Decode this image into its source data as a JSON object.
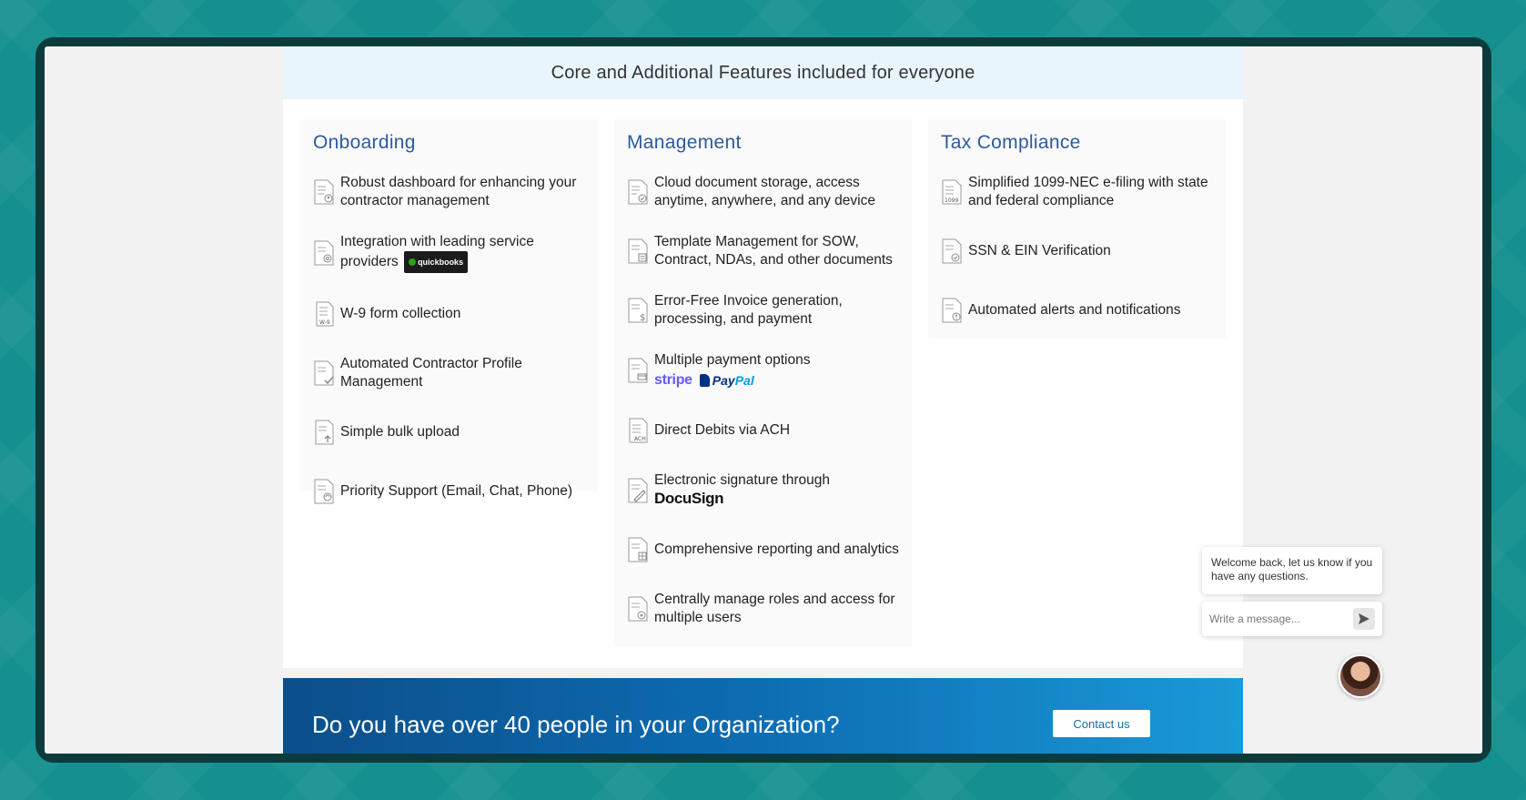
{
  "banner": {
    "title": "Core and Additional Features included for everyone"
  },
  "columns": [
    {
      "title": "Onboarding",
      "items": [
        "Robust dashboard for enhancing your contractor management",
        "Integration with leading service providers",
        "W-9 form collection",
        "Automated Contractor Profile Management",
        "Simple bulk upload",
        "Priority Support (Email, Chat, Phone)"
      ],
      "logos": {
        "quickbooks": "quickbooks",
        "w9": "W-9"
      }
    },
    {
      "title": "Management",
      "items": [
        "Cloud document storage, access anytime, anywhere, and any device",
        "Template Management for SOW, Contract, NDAs, and other documents",
        "Error-Free Invoice generation, processing, and payment",
        "Multiple payment options",
        "Direct Debits via ACH",
        "Electronic signature through",
        "Comprehensive reporting and analytics",
        "Centrally manage roles and access for multiple users"
      ],
      "logos": {
        "stripe": "stripe",
        "paypal_a": "Pay",
        "paypal_b": "Pal",
        "docusign": "DocuSign",
        "ach": "ACH"
      }
    },
    {
      "title": "Tax Compliance",
      "items": [
        "Simplified 1099-NEC e-filing with state and federal compliance",
        "SSN & EIN Verification",
        "Automated alerts and notifications"
      ],
      "logos": {
        "form1099": "1099"
      }
    }
  ],
  "cta": {
    "title": "Do you have over 40 people in your Organization?",
    "button": "Contact us"
  },
  "chat": {
    "welcome": "Welcome back, let us know if you have any questions.",
    "placeholder": "Write a message..."
  },
  "colors": {
    "background": "#13908f",
    "accent": "#2c5aa0",
    "banner": "#e8f5fd",
    "cta_start": "#0b4f8a",
    "cta_end": "#1a9ad6"
  }
}
